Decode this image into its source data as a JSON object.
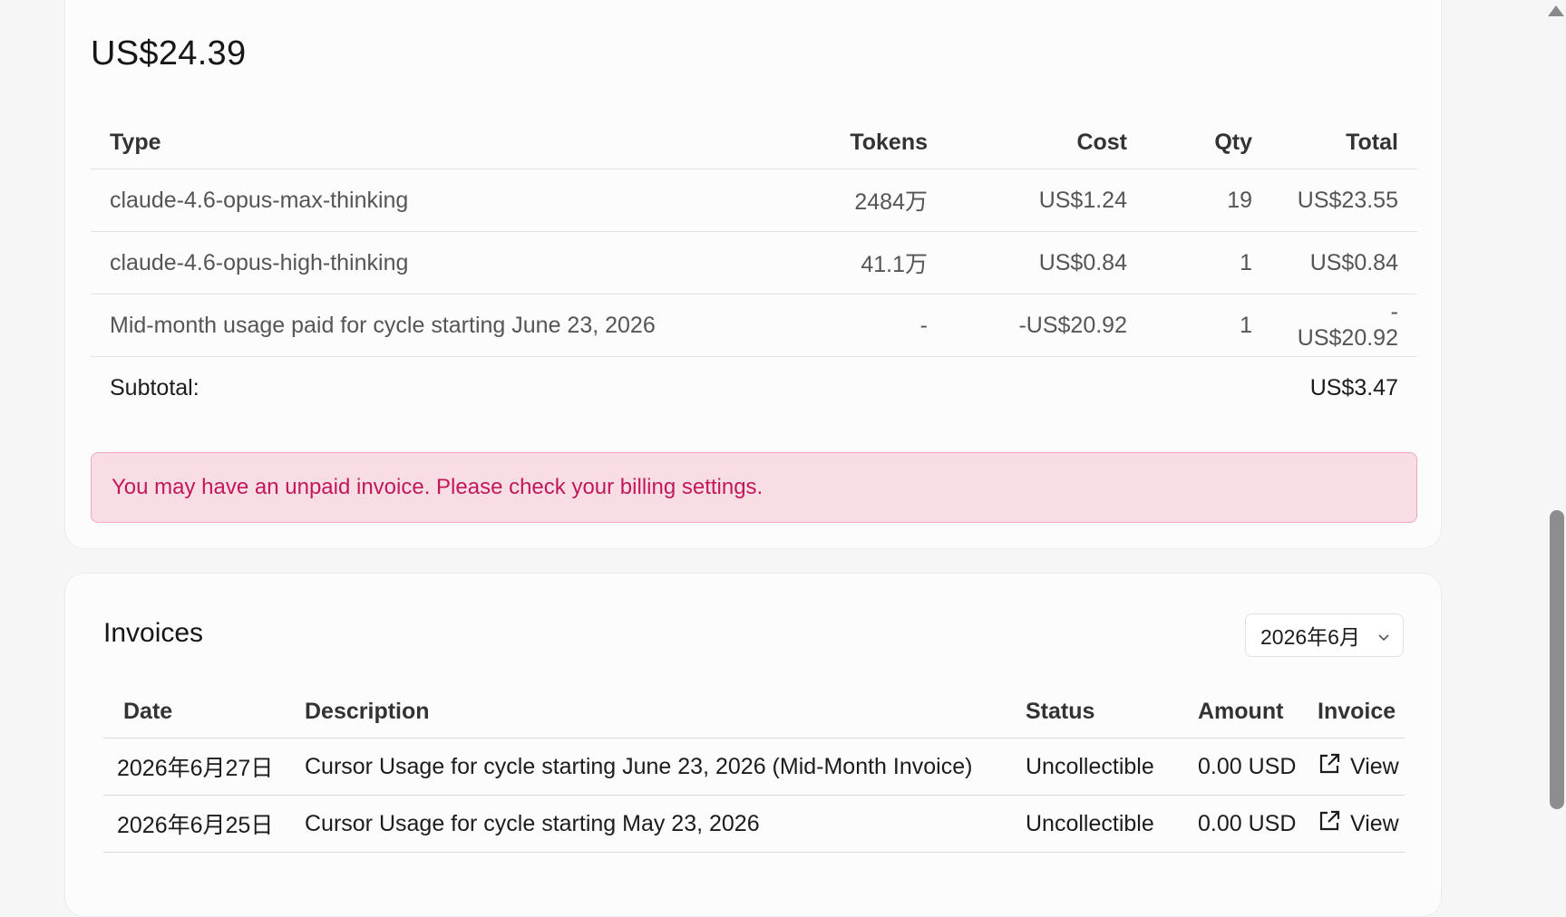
{
  "usage": {
    "total": "US$24.39",
    "columns": {
      "type": "Type",
      "tokens": "Tokens",
      "cost": "Cost",
      "qty": "Qty",
      "total": "Total"
    },
    "rows": [
      {
        "type": "claude-4.6-opus-max-thinking",
        "tokens": "2484万",
        "cost": "US$1.24",
        "qty": "19",
        "total": "US$23.55"
      },
      {
        "type": "claude-4.6-opus-high-thinking",
        "tokens": "41.1万",
        "cost": "US$0.84",
        "qty": "1",
        "total": "US$0.84"
      },
      {
        "type": "Mid-month usage paid for cycle starting June 23, 2026",
        "tokens": "-",
        "cost": "-US$20.92",
        "qty": "1",
        "total": "-US$20.92"
      }
    ],
    "subtotal_label": "Subtotal:",
    "subtotal_value": "US$3.47",
    "alert": "You may have an unpaid invoice. Please check your billing settings."
  },
  "invoices": {
    "title": "Invoices",
    "month_selected": "2026年6月",
    "columns": {
      "date": "Date",
      "description": "Description",
      "status": "Status",
      "amount": "Amount",
      "invoice": "Invoice"
    },
    "rows": [
      {
        "date": "2026年6月27日",
        "description": "Cursor Usage for cycle starting June 23, 2026 (Mid-Month Invoice)",
        "status": "Uncollectible",
        "amount": "0.00 USD",
        "link": "View"
      },
      {
        "date": "2026年6月25日",
        "description": "Cursor Usage for cycle starting May 23, 2026",
        "status": "Uncollectible",
        "amount": "0.00 USD",
        "link": "View"
      }
    ]
  },
  "colors": {
    "alert_bg": "#f8dde4",
    "alert_text": "#c2185b",
    "alert_border": "#efa9bc"
  },
  "icons": {
    "external_link": "external-link-icon",
    "chevron": "chevron-down-icon"
  }
}
